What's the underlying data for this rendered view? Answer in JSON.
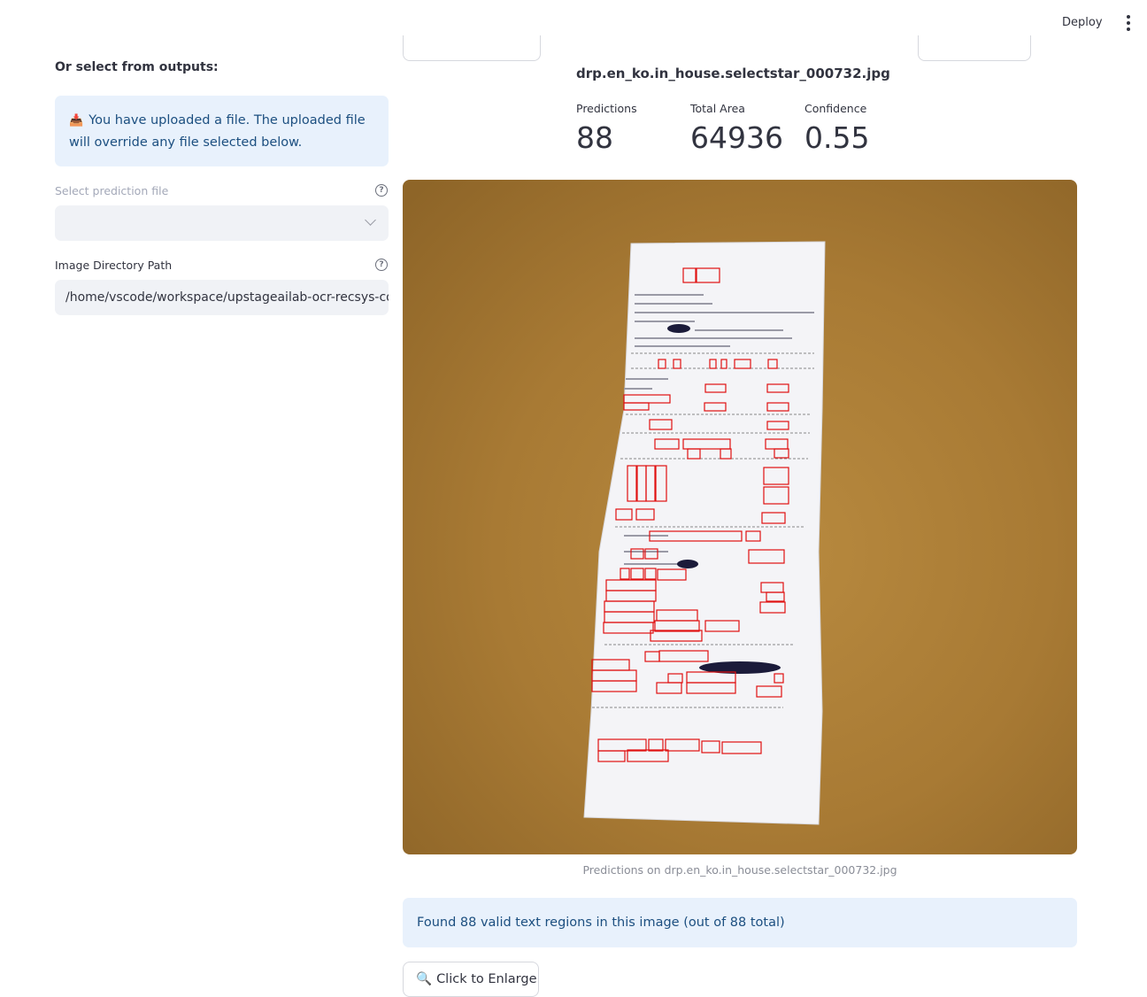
{
  "topbar": {
    "deploy_label": "Deploy",
    "menu_icon": "kebab-menu-icon"
  },
  "sidebar": {
    "subheader": "Or select from outputs:",
    "info_icon": "📥",
    "info_text": "You have uploaded a file. The uploaded file will override any file selected below.",
    "select_prediction": {
      "label": "Select prediction file",
      "value": ""
    },
    "image_dir": {
      "label": "Image Directory Path",
      "value": "/home/vscode/workspace/upstageailab-ocr-recsys-competition"
    }
  },
  "main": {
    "filename": "drp.en_ko.in_house.selectstar_000732.jpg",
    "metrics": [
      {
        "label": "Predictions",
        "value": "88"
      },
      {
        "label": "Total Area",
        "value": "64936"
      },
      {
        "label": "Confidence",
        "value": "0.55"
      }
    ],
    "caption": "Predictions on drp.en_ko.in_house.selectstar_000732.jpg",
    "found_text": "Found 88 valid text regions in this image (out of 88 total)",
    "enlarge_label": "Click to Enlarge",
    "colors": {
      "info_bg": "#e8f1fc",
      "info_text": "#1c4f80",
      "box": "#e01010"
    }
  }
}
